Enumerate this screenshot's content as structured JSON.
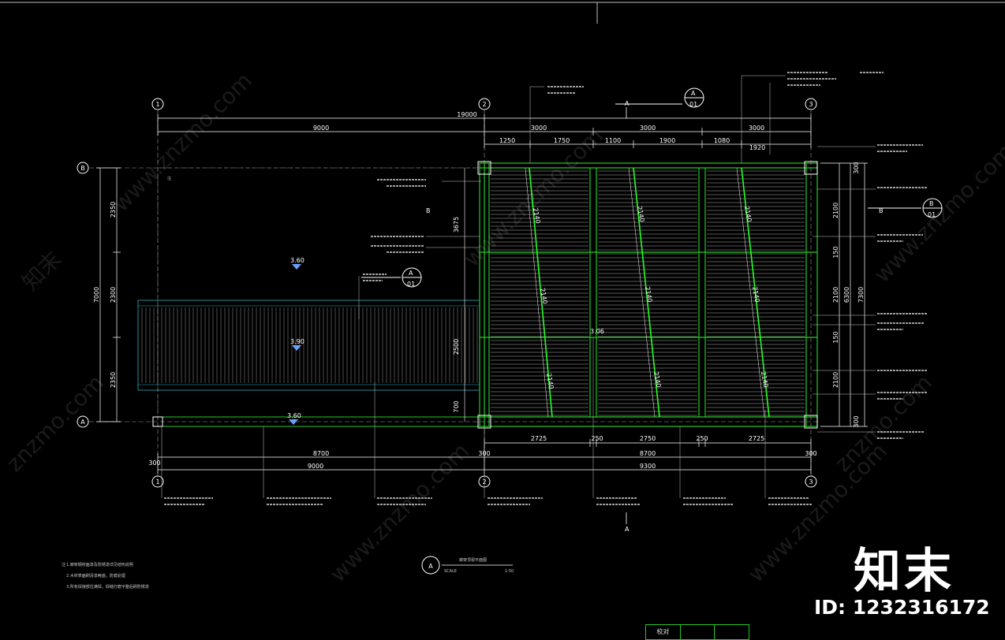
{
  "drawing": {
    "overall_dimension": "19000",
    "top_spans": [
      "9000",
      "3000",
      "3000",
      "3000"
    ],
    "top_sub_spans": [
      "1250",
      "1750",
      "1100",
      "1900",
      "1080",
      "1920"
    ],
    "bottom_spans_row1": [
      "2725",
      "250",
      "2750",
      "250",
      "2725"
    ],
    "bottom_spans_row2": [
      "300",
      "8700",
      "300",
      "8700",
      "300"
    ],
    "bottom_spans_row3": [
      "9000",
      "9300"
    ],
    "left_spans": [
      "2350",
      "2300",
      "2350"
    ],
    "left_total": "7000",
    "right_spans": [
      "300",
      "2100",
      "150",
      "2100",
      "150",
      "2100",
      "300"
    ],
    "right_totals": [
      "6300",
      "7300"
    ],
    "inner_vertical_dims": [
      "3675",
      "2500",
      "700"
    ],
    "grid_axes": {
      "columns": [
        "1",
        "2",
        "3"
      ],
      "rows": [
        "A",
        "B"
      ]
    },
    "elevations": [
      "3.60",
      "3.90",
      "3.60",
      "3.06"
    ],
    "section_marks": [
      "A",
      "B",
      "A",
      "B"
    ],
    "rafter_labels": [
      "2140",
      "2140",
      "2140",
      "2140",
      "2140",
      "2140",
      "2140",
      "2140",
      "2140"
    ],
    "plan_title": "廊架顶视平面图",
    "plan_label": "A",
    "scale_label": "SCALE",
    "scale_value": "1:50",
    "section_refs": [
      "A",
      "01",
      "B",
      "01"
    ],
    "notes_heading": "注",
    "notes": [
      "1.廊架钢材面漆及防锈漆详见结构说明",
      "2.木材表面刷清漆两遍，防腐处理",
      "3.所有焊接部位满焊，焊缝打磨平整后刷防锈漆"
    ]
  },
  "watermark": {
    "site": "www.znzmo.com",
    "brand_cn": "知末",
    "brand_en": "znzmo.com",
    "id_text": "ID: 1232316172"
  },
  "title_block": {
    "label": "校对"
  }
}
